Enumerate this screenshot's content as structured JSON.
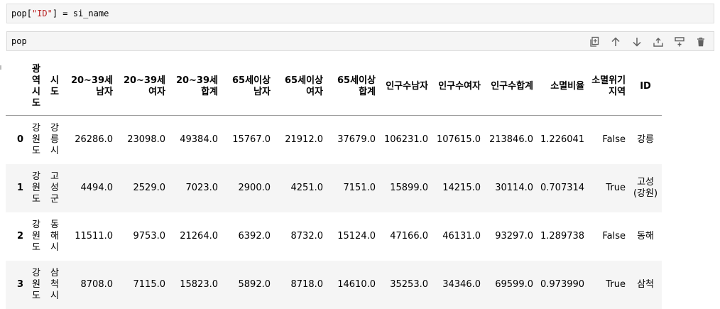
{
  "cell1": {
    "code": {
      "var": "pop",
      "key": "\"ID\"",
      "rest": "] = si_name",
      "open": "["
    }
  },
  "cell2": {
    "code": "pop"
  },
  "toolbar": [
    {
      "name": "duplicate-icon"
    },
    {
      "name": "move-up-icon"
    },
    {
      "name": "move-down-icon"
    },
    {
      "name": "insert-above-icon"
    },
    {
      "name": "insert-below-icon"
    },
    {
      "name": "delete-icon"
    }
  ],
  "table": {
    "columns": [
      "광역시도",
      "시도",
      "20~39세 남자",
      "20~39세 여자",
      "20~39세 합계",
      "65세이상 남자",
      "65세이상 여자",
      "65세이상 합계",
      "인구수남자",
      "인구수여자",
      "인구수합계",
      "소멸비율",
      "소멸위기지역",
      "ID"
    ],
    "rows": [
      {
        "index": "0",
        "cells": [
          "강원도",
          "강릉시",
          "26286.0",
          "23098.0",
          "49384.0",
          "15767.0",
          "21912.0",
          "37679.0",
          "106231.0",
          "107615.0",
          "213846.0",
          "1.226041",
          "False",
          "강릉"
        ]
      },
      {
        "index": "1",
        "cells": [
          "강원도",
          "고성군",
          "4494.0",
          "2529.0",
          "7023.0",
          "2900.0",
          "4251.0",
          "7151.0",
          "15899.0",
          "14215.0",
          "30114.0",
          "0.707314",
          "True",
          "고성(강원)"
        ]
      },
      {
        "index": "2",
        "cells": [
          "강원도",
          "동해시",
          "11511.0",
          "9753.0",
          "21264.0",
          "6392.0",
          "8732.0",
          "15124.0",
          "47166.0",
          "46131.0",
          "93297.0",
          "1.289738",
          "False",
          "동해"
        ]
      },
      {
        "index": "3",
        "cells": [
          "강원도",
          "삼척시",
          "8708.0",
          "7115.0",
          "15823.0",
          "5892.0",
          "8718.0",
          "14610.0",
          "35253.0",
          "34346.0",
          "69599.0",
          "0.973990",
          "True",
          "삼척"
        ]
      }
    ]
  }
}
